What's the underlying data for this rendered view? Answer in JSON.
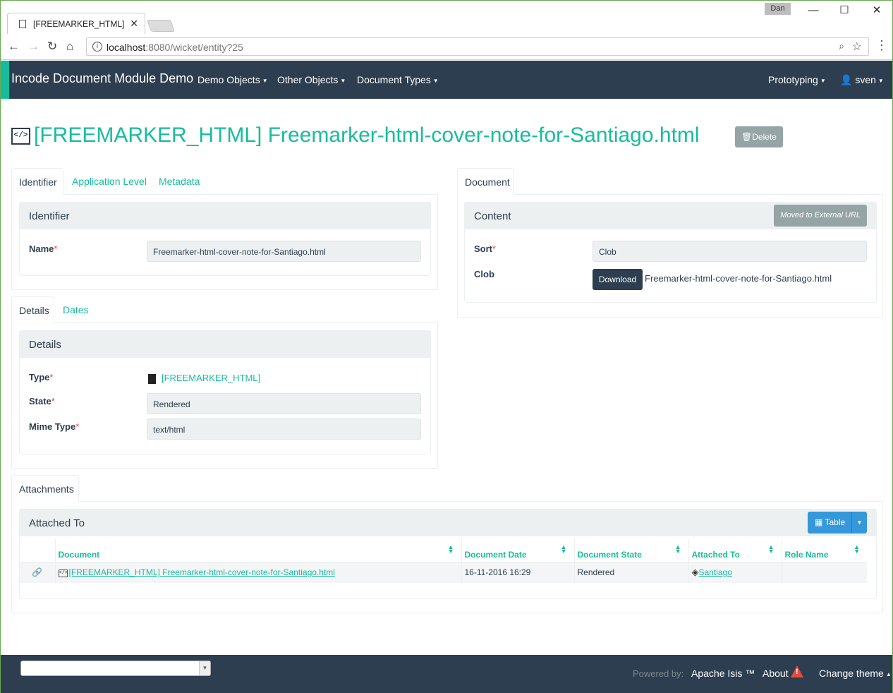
{
  "browser": {
    "tab_title": "[FREEMARKER_HTML] Freemarker-html-cover-note-for-Santiago.html",
    "user_chip": "Dan",
    "url_host": "localhost",
    "url_rest": ":8080/wicket/entity?25"
  },
  "navbar": {
    "brand": "Incode Document Module Demo",
    "menus": [
      "Demo Objects",
      "Other Objects",
      "Document Types"
    ],
    "prototyping": "Prototyping",
    "user": "sven"
  },
  "page": {
    "title": "[FREEMARKER_HTML] Freemarker-html-cover-note-for-Santiago.html",
    "delete_label": "Delete"
  },
  "left_tabs": {
    "tabs": [
      "Identifier",
      "Application Level",
      "Metadata"
    ],
    "identifier_panel": {
      "heading": "Identifier",
      "name_label": "Name",
      "name_value": "Freemarker-html-cover-note-for-Santiago.html"
    }
  },
  "details_tabs": {
    "tabs": [
      "Details",
      "Dates"
    ],
    "panel": {
      "heading": "Details",
      "type_label": "Type",
      "type_value": "[FREEMARKER_HTML]",
      "state_label": "State",
      "state_value": "Rendered",
      "mime_label": "Mime Type",
      "mime_value": "text/html"
    }
  },
  "document_tab": {
    "tab": "Document",
    "panel": {
      "heading": "Content",
      "moved_label": "Moved to External URL",
      "sort_label": "Sort",
      "sort_value": "Clob",
      "clob_label": "Clob",
      "download_label": "Download",
      "clob_filename": "Freemarker-html-cover-note-for-Santiago.html"
    }
  },
  "attachments": {
    "tab": "Attachments",
    "heading": "Attached To",
    "view_label": "Table",
    "columns": [
      "Document",
      "Document Date",
      "Document State",
      "Attached To",
      "Role Name"
    ],
    "rows": [
      {
        "document": "[FREEMARKER_HTML] Freemarker-html-cover-note-for-Santiago.html",
        "date": "16-11-2016 16:29",
        "state": "Rendered",
        "attached_to": "Santiago",
        "role": ""
      }
    ]
  },
  "footer": {
    "powered_by": "Powered by:",
    "isis": "Apache Isis ™",
    "about": "About",
    "change_theme": "Change theme"
  },
  "colors": {
    "navbar": "#2c3e50",
    "accent": "#18bc9c",
    "required": "#e74c3c",
    "table_button": "#3498db",
    "muted_button": "#95a5a6"
  }
}
